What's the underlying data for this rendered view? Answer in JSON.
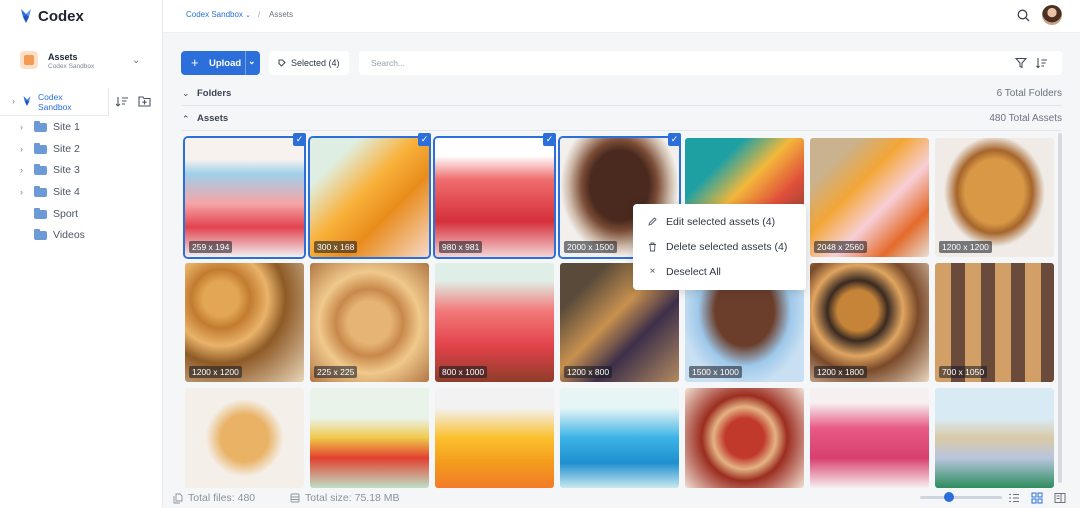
{
  "app": {
    "name": "Codex"
  },
  "sidebar": {
    "workspace": {
      "title": "Assets",
      "subtitle": "Codex Sandbox"
    },
    "root": {
      "label_line1": "Codex",
      "label_line2": "Sandbox"
    },
    "items": [
      {
        "label": "Site 1",
        "expandable": true
      },
      {
        "label": "Site 2",
        "expandable": true
      },
      {
        "label": "Site 3",
        "expandable": true
      },
      {
        "label": "Site 4",
        "expandable": true
      },
      {
        "label": "Sport",
        "expandable": false
      },
      {
        "label": "Videos",
        "expandable": false
      }
    ]
  },
  "breadcrumb": {
    "parent": "Codex Sandbox",
    "separator": "/",
    "current": "Assets"
  },
  "toolbar": {
    "upload_label": "Upload",
    "selected_label": "Selected (4)",
    "search_placeholder": "Search..."
  },
  "sections": {
    "folders": {
      "label": "Folders",
      "count": "6 Total Folders"
    },
    "assets": {
      "label": "Assets",
      "count": "480 Total Assets"
    }
  },
  "assets": [
    {
      "dim": "259 x 194",
      "selected": true
    },
    {
      "dim": "300 x 168",
      "selected": true
    },
    {
      "dim": "980 x 981",
      "selected": true
    },
    {
      "dim": "2000 x 1500",
      "selected": true
    },
    {
      "dim": "",
      "selected": false
    },
    {
      "dim": "2048 x 2560",
      "selected": false
    },
    {
      "dim": "1200 x 1200",
      "selected": false
    },
    {
      "dim": "1200 x 1200",
      "selected": false
    },
    {
      "dim": "225 x 225",
      "selected": false
    },
    {
      "dim": "800 x 1000",
      "selected": false
    },
    {
      "dim": "1200 x 800",
      "selected": false
    },
    {
      "dim": "1500 x 1000",
      "selected": false
    },
    {
      "dim": "1200 x 1800",
      "selected": false
    },
    {
      "dim": "700 x 1050",
      "selected": false
    },
    {
      "dim": "",
      "selected": false
    },
    {
      "dim": "",
      "selected": false
    },
    {
      "dim": "",
      "selected": false
    },
    {
      "dim": "",
      "selected": false
    },
    {
      "dim": "",
      "selected": false
    },
    {
      "dim": "",
      "selected": false
    },
    {
      "dim": "",
      "selected": false
    }
  ],
  "context_menu": {
    "items": [
      {
        "label": "Edit selected assets (4)",
        "icon": "pencil-icon"
      },
      {
        "label": "Delete selected assets (4)",
        "icon": "trash-icon"
      },
      {
        "label": "Deselect All",
        "icon": "close-icon"
      }
    ]
  },
  "footer": {
    "total_files": "Total files: 480",
    "total_size": "Total size: 75.18 MB",
    "zoom_level": 0.35
  },
  "colors": {
    "accent": "#2c6fdb",
    "selected_outline": "#2c6fdb"
  }
}
